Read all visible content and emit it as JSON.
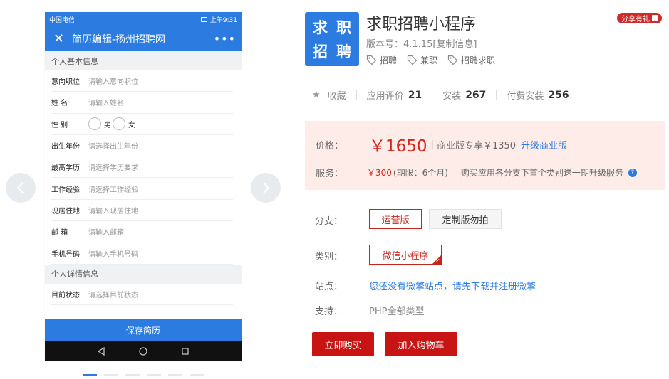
{
  "carousel": {
    "prev_glyph": "‹",
    "next_glyph": "›",
    "dot_count": 6,
    "active_dot": 0
  },
  "phone": {
    "carrier": "中国电信",
    "time": "上午9:31",
    "title": "简历编辑-扬州招聘网",
    "close_glyph": "✕",
    "more_glyph": "•••",
    "section_basic": "个人基本信息",
    "section_detail": "个人详情信息",
    "fields": [
      {
        "label": "意向职位",
        "placeholder": "请输入意向职位"
      },
      {
        "label": "姓 名",
        "placeholder": "请输入姓名"
      },
      {
        "label": "性 别",
        "radio": [
          "男",
          "女"
        ]
      },
      {
        "label": "出生年份",
        "placeholder": "请选择出生年份"
      },
      {
        "label": "最高学历",
        "placeholder": "请选择学历要求"
      },
      {
        "label": "工作经验",
        "placeholder": "请选择工作经验"
      },
      {
        "label": "现居住地",
        "placeholder": "请输入现居住地"
      },
      {
        "label": "邮 箱",
        "placeholder": "请输入邮箱"
      },
      {
        "label": "手机号码",
        "placeholder": "请输入手机号码"
      }
    ],
    "detail_fields": [
      {
        "label": "目前状态",
        "placeholder": "请选择目前状态"
      }
    ],
    "save_label": "保存简历"
  },
  "product": {
    "icon_chars": [
      "求",
      "职",
      "招",
      "聘"
    ],
    "title": "求职招聘小程序",
    "share_label": "分享有礼",
    "version": "版本号：4.1.15[复制信息]",
    "tags": [
      "招聘",
      "兼职",
      "招聘求职"
    ],
    "favorite_label": "收藏",
    "rating_label": "应用评价",
    "rating_value": "21",
    "install_label": "安装",
    "install_value": "267",
    "paid_label": "付费安装",
    "paid_value": "256"
  },
  "pricing": {
    "price_label": "价格：",
    "price": "￥1650",
    "business_price": "商业版专享￥1350",
    "upgrade_label": "升级商业版",
    "service_label": "服务：",
    "service_price": "￥300",
    "service_period": "(期限：6个月)",
    "service_note": "购买应用各分支下首个类别送一期升级服务",
    "help_glyph": "?"
  },
  "options": {
    "branch_label": "分支：",
    "branches": [
      "运营版",
      "定制版勿拍"
    ],
    "category_label": "类别：",
    "category": "微信小程序",
    "site_label": "站点：",
    "site_text": "您还没有微擎站点，请先下载并注册微擎",
    "support_label": "支持：",
    "support_text": "PHP全部类型",
    "buy_label": "立即购买",
    "cart_label": "加入购物车"
  },
  "colors": {
    "accent_blue": "#2b7be0",
    "accent_red": "#d5231b",
    "price_bg": "#fdece8"
  }
}
